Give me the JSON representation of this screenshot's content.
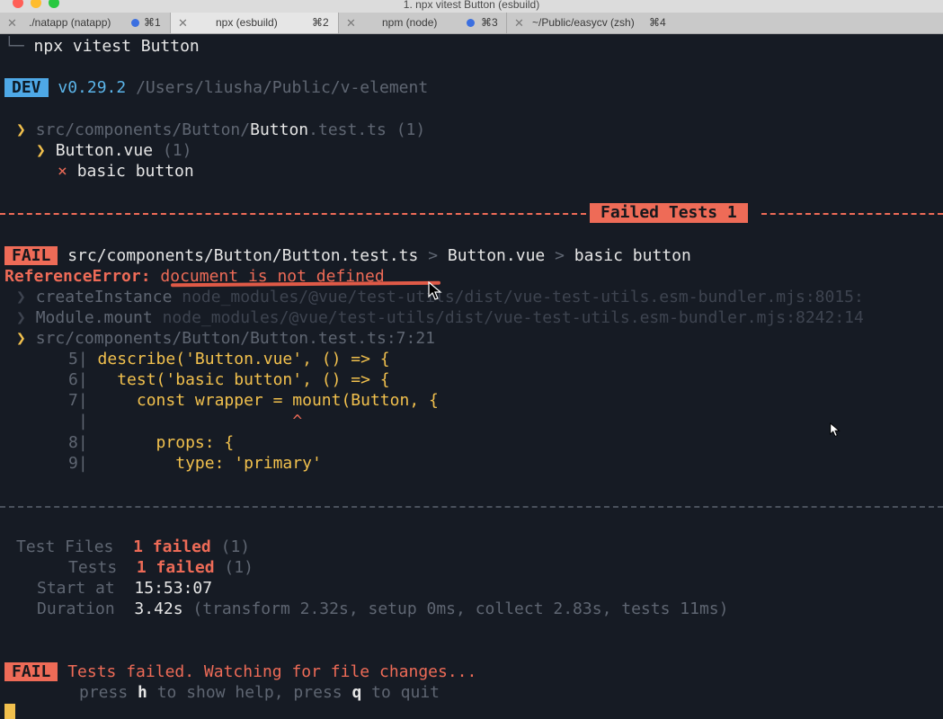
{
  "window": {
    "title": "1. npx vitest Button (esbuild)"
  },
  "tabs": [
    {
      "label": "./natapp (natapp)",
      "shortcut": "⌘1",
      "has_dot": true
    },
    {
      "label": "npx (esbuild)",
      "shortcut": "⌘2",
      "has_dot": false
    },
    {
      "label": "npm (node)",
      "shortcut": "⌘3",
      "has_dot": true
    },
    {
      "label": "~/Public/easycv (zsh)",
      "shortcut": "⌘4",
      "has_dot": false
    }
  ],
  "terminal": {
    "command_line": {
      "prefix": "└─",
      "command": "npx vitest Button"
    },
    "dev_line": {
      "badge": "DEV",
      "version": "v0.29.2",
      "path": "/Users/liusha/Public/v-element"
    },
    "tree": {
      "file": {
        "arrow": "❯",
        "dir": "src/components/Button/",
        "name": "Button",
        "suffix": ".test.ts",
        "count": "(1)"
      },
      "suite": {
        "arrow": "❯",
        "name": "Button.vue",
        "count": "(1)"
      },
      "test": {
        "mark": "×",
        "name": "basic button"
      }
    },
    "failed_banner": "Failed Tests 1",
    "fail_header": {
      "badge": "FAIL",
      "file": "src/components/Button/Button.test.ts",
      "sep1": ">",
      "suite": "Button.vue",
      "sep2": ">",
      "test": "basic button"
    },
    "error": {
      "type": "ReferenceError:",
      "message": "document is not defined"
    },
    "stack": [
      {
        "arrow": "❯",
        "fn": "createInstance",
        "loc": "node_modules/@vue/test-utils/dist/vue-test-utils.esm-bundler.mjs:8015:"
      },
      {
        "arrow": "❯",
        "fn": "Module.mount",
        "loc": "node_modules/@vue/test-utils/dist/vue-test-utils.esm-bundler.mjs:8242:14"
      },
      {
        "arrow": "❯",
        "fn": "",
        "loc": "src/components/Button/Button.test.ts:7:21"
      }
    ],
    "code": [
      {
        "no": "5",
        "code": "describe('Button.vue', () => {"
      },
      {
        "no": "6",
        "code": "  test('basic button', () => {"
      },
      {
        "no": "7",
        "code": "    const wrapper = mount(Button, {"
      },
      {
        "no": "",
        "code": "                    ^"
      },
      {
        "no": "8",
        "code": "      props: {"
      },
      {
        "no": "9",
        "code": "        type: 'primary'"
      }
    ],
    "summary": {
      "test_files": {
        "label": "Test Files",
        "value": "1 failed",
        "extra": "(1)"
      },
      "tests": {
        "label": "Tests",
        "value": "1 failed",
        "extra": "(1)"
      },
      "start_at": {
        "label": "Start at",
        "value": "15:53:07"
      },
      "duration": {
        "label": "Duration",
        "value": "3.42s",
        "extra": "(transform 2.32s, setup 0ms, collect 2.83s, tests 11ms)"
      }
    },
    "footer": {
      "badge": "FAIL",
      "message": "Tests failed. Watching for file changes...",
      "help": {
        "p1": "press ",
        "key1": "h",
        "p2": " to show help, press ",
        "key2": "q",
        "p3": " to quit"
      }
    }
  }
}
